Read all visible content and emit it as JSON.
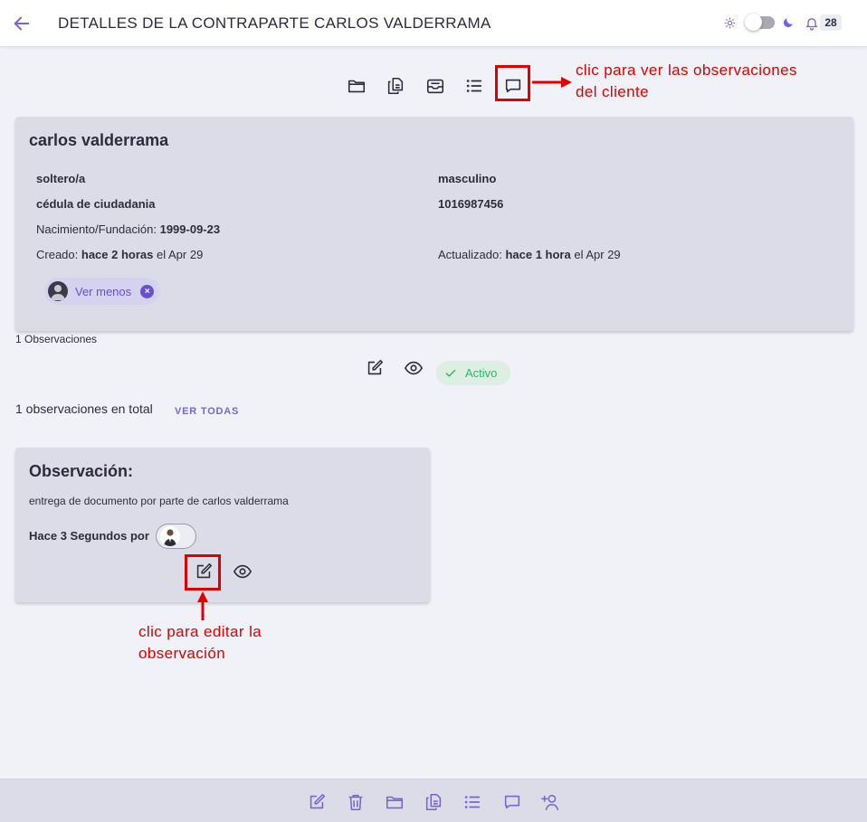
{
  "header": {
    "title": "DETALLES DE LA CONTRAPARTE CARLOS VALDERRAMA",
    "notification_count": "28"
  },
  "annotations": {
    "observations_hint_line1": "clic para ver las observaciones",
    "observations_hint_line2": "del cliente",
    "edit_hint_line1": "clic para editar la",
    "edit_hint_line2": "observación"
  },
  "client": {
    "name": "carlos valderrama",
    "marital_status": "soltero/a",
    "gender": "masculino",
    "id_type": "cédula de ciudadania",
    "id_number": "1016987456",
    "birth_label": "Nacimiento/Fundación:",
    "birth_date": "1999-09-23",
    "created_label": "Creado:",
    "created_relative": "hace 2 horas",
    "created_suffix": "el Apr 29",
    "updated_label": "Actualizado:",
    "updated_relative": "hace 1 hora",
    "updated_suffix": "el Apr 29",
    "chip_label": "Ver menos",
    "chip_close": "×"
  },
  "observations": {
    "count_label": "1 Observaciones",
    "status": "Activo",
    "total_label": "1 observaciones en total",
    "view_all": "VER TODAS",
    "card": {
      "title": "Observación:",
      "body": "entrega de documento por parte de carlos valderrama",
      "meta": "Hace 3 Segundos por"
    }
  },
  "colors": {
    "accent": "#7a63d8",
    "annotation_red": "#e00000",
    "card_bg": "#dcdce8",
    "status_green": "#2fb36a"
  },
  "icons": {
    "toolbar": [
      "folder-icon",
      "documents-icon",
      "inbox-icon",
      "list-icon",
      "comment-icon"
    ],
    "observation_actions": [
      "edit-icon",
      "eye-icon"
    ],
    "bottom": [
      "edit-icon",
      "trash-icon",
      "folder-icon",
      "documents-icon",
      "list-icon",
      "comment-icon",
      "user-plus-icon"
    ]
  }
}
